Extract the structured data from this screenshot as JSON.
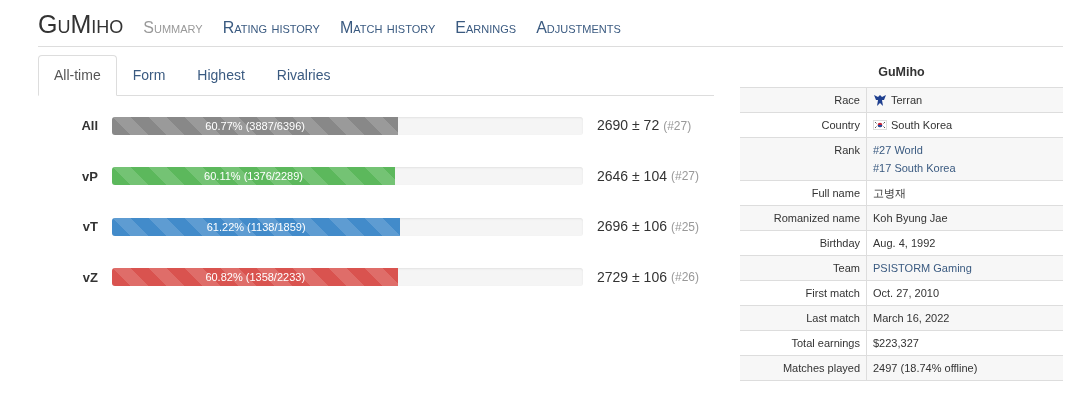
{
  "header": {
    "title": "GuMiho",
    "nav": [
      {
        "label": "Summary",
        "selected": true
      },
      {
        "label": "Rating history",
        "selected": false
      },
      {
        "label": "Match history",
        "selected": false
      },
      {
        "label": "Earnings",
        "selected": false
      },
      {
        "label": "Adjustments",
        "selected": false
      }
    ]
  },
  "tabs": [
    {
      "label": "All-time",
      "selected": true
    },
    {
      "label": "Form",
      "selected": false
    },
    {
      "label": "Highest",
      "selected": false
    },
    {
      "label": "Rivalries",
      "selected": false
    }
  ],
  "matchups": [
    {
      "label": "All",
      "level": 0.6077,
      "color": "#888888",
      "bar_text": "60.77% (3887/6396)",
      "rating": "2690 ± 72",
      "rank": "(#27)"
    },
    {
      "label": "vP",
      "level": 0.6011,
      "color": "#5cb85c",
      "bar_text": "60.11% (1376/2289)",
      "rating": "2646 ± 104",
      "rank": "(#27)"
    },
    {
      "label": "vT",
      "level": 0.6122,
      "color": "#428bca",
      "bar_text": "61.22% (1138/1859)",
      "rating": "2696 ± 106",
      "rank": "(#25)"
    },
    {
      "label": "vZ",
      "level": 0.6082,
      "color": "#d9534f",
      "bar_text": "60.82% (1358/2233)",
      "rating": "2729 ± 106",
      "rank": "(#26)"
    }
  ],
  "infobox": {
    "title": "GuMiho",
    "rows": [
      {
        "label": "Race",
        "kind": "race",
        "values": [
          "Terran"
        ]
      },
      {
        "label": "Country",
        "kind": "country",
        "values": [
          "South Korea"
        ]
      },
      {
        "label": "Rank",
        "kind": "link",
        "values": [
          "#27 World",
          "#17 South Korea"
        ]
      },
      {
        "label": "Full name",
        "kind": "text",
        "values": [
          "고병재"
        ]
      },
      {
        "label": "Romanized name",
        "kind": "text",
        "values": [
          "Koh Byung Jae"
        ]
      },
      {
        "label": "Birthday",
        "kind": "text",
        "values": [
          "Aug. 4, 1992"
        ]
      },
      {
        "label": "Team",
        "kind": "link",
        "values": [
          "PSISTORM Gaming"
        ]
      },
      {
        "label": "First match",
        "kind": "text",
        "values": [
          "Oct. 27, 2010"
        ]
      },
      {
        "label": "Last match",
        "kind": "text",
        "values": [
          "March 16, 2022"
        ]
      },
      {
        "label": "Total earnings",
        "kind": "text",
        "values": [
          "$223,327"
        ]
      },
      {
        "label": "Matches played",
        "kind": "text",
        "values": [
          "2497 (18.74% offline)"
        ]
      }
    ]
  }
}
